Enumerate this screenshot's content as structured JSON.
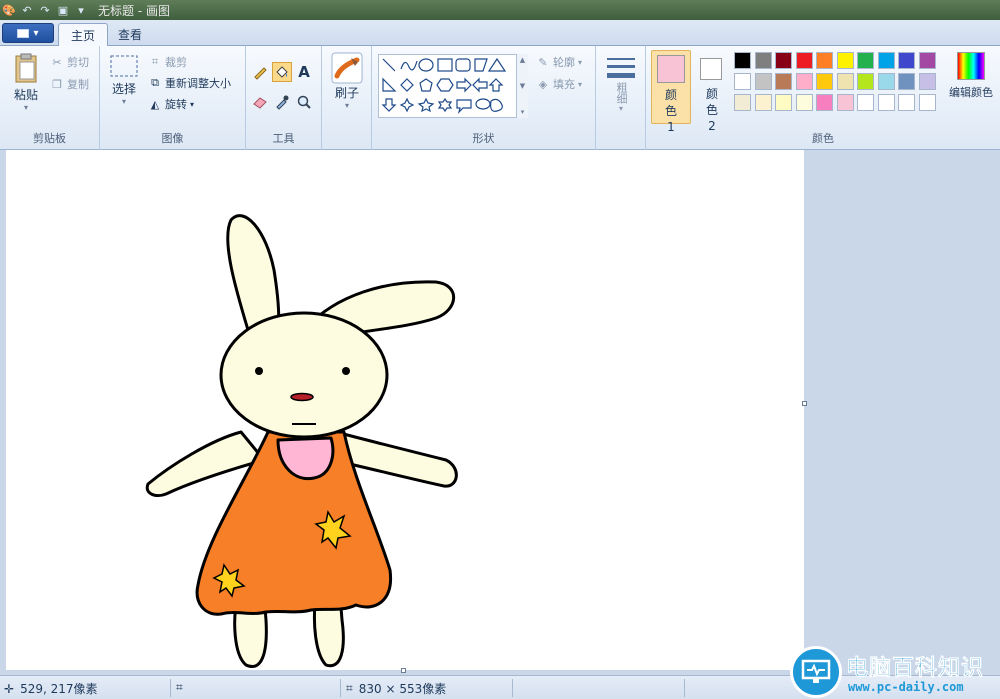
{
  "window": {
    "title": "无标题 - 画图"
  },
  "tabs": [
    {
      "label": "主页"
    },
    {
      "label": "查看"
    }
  ],
  "ribbon": {
    "clipboard": {
      "paste": "粘贴",
      "cut": "剪切",
      "copy": "复制",
      "group": "剪贴板"
    },
    "image": {
      "select": "选择",
      "crop": "裁剪",
      "resize": "重新调整大小",
      "rotate": "旋转",
      "group": "图像"
    },
    "tools": {
      "group": "工具",
      "selected": "fill-tool"
    },
    "brushes": {
      "label": "刷子"
    },
    "shapes": {
      "outline": "轮廓",
      "fill": "填充",
      "group": "形状"
    },
    "size": {
      "label": "粗细"
    },
    "colors": {
      "color1_label": "颜色 1",
      "color2_label": "颜色 2",
      "edit": "编辑颜色",
      "group": "颜色",
      "color1": "#f9c3d6",
      "color2": "#ffffff",
      "palette_row1": [
        "#000000",
        "#7f7f7f",
        "#880015",
        "#ed1c24",
        "#ff7f27",
        "#fff200",
        "#22b14c",
        "#00a2e8",
        "#3f48cc",
        "#a349a4"
      ],
      "palette_row2": [
        "#ffffff",
        "#c3c3c3",
        "#b97a57",
        "#ffaec9",
        "#ffc90e",
        "#efe4b0",
        "#b5e61d",
        "#99d9ea",
        "#7092be",
        "#c8bfe7"
      ],
      "palette_row3": [
        "#f3ecd4",
        "#fdf2cf",
        "#fefbc3",
        "#fdfcdc",
        "#f77fc0",
        "#f9c3d6",
        "#ffffff",
        "#ffffff",
        "#ffffff",
        "#ffffff"
      ]
    }
  },
  "status": {
    "cursor": "529, 217像素",
    "selection": "",
    "canvas_size": "830 × 553像素"
  },
  "watermark": {
    "title": "电脑百科知识",
    "url": "www.pc-daily.com"
  }
}
